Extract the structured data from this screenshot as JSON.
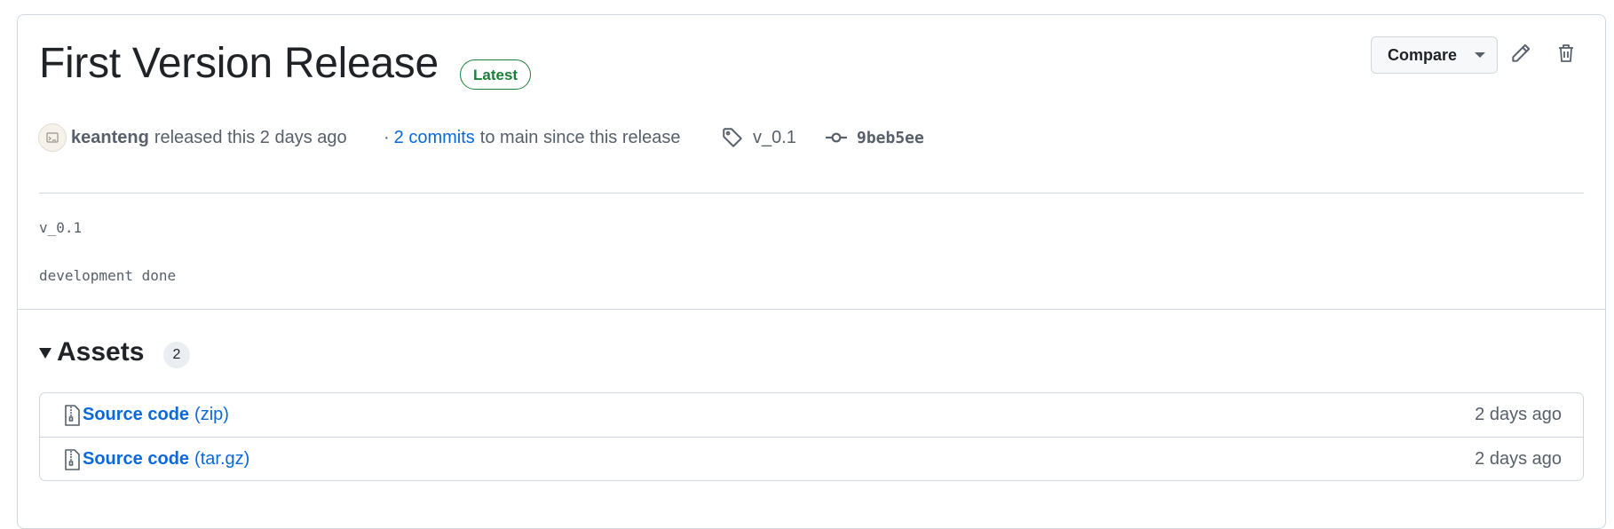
{
  "release": {
    "title": "First Version Release",
    "badge": "Latest",
    "compare_label": "Compare",
    "author": "keanteng",
    "released_text": "released this 2 days ago",
    "commits_prefix": "·",
    "commits_link": "2 commits",
    "commits_suffix": "to main since this release",
    "tag": "v_0.1",
    "commit_sha": "9beb5ee"
  },
  "notes": {
    "line1": "v_0.1",
    "line2": "development done"
  },
  "assets": {
    "title": "Assets",
    "count": "2",
    "items": [
      {
        "name": "Source code",
        "ext": "(zip)",
        "when": "2 days ago"
      },
      {
        "name": "Source code",
        "ext": "(tar.gz)",
        "when": "2 days ago"
      }
    ]
  },
  "colors": {
    "accent": "#0969da",
    "success": "#1a7f37",
    "muted": "#57606a",
    "border": "#d0d7de"
  },
  "icons": [
    "pencil-icon",
    "trash-icon",
    "tag-icon",
    "commit-icon",
    "file-zip-icon",
    "avatar-icon",
    "triangle-down-icon"
  ]
}
